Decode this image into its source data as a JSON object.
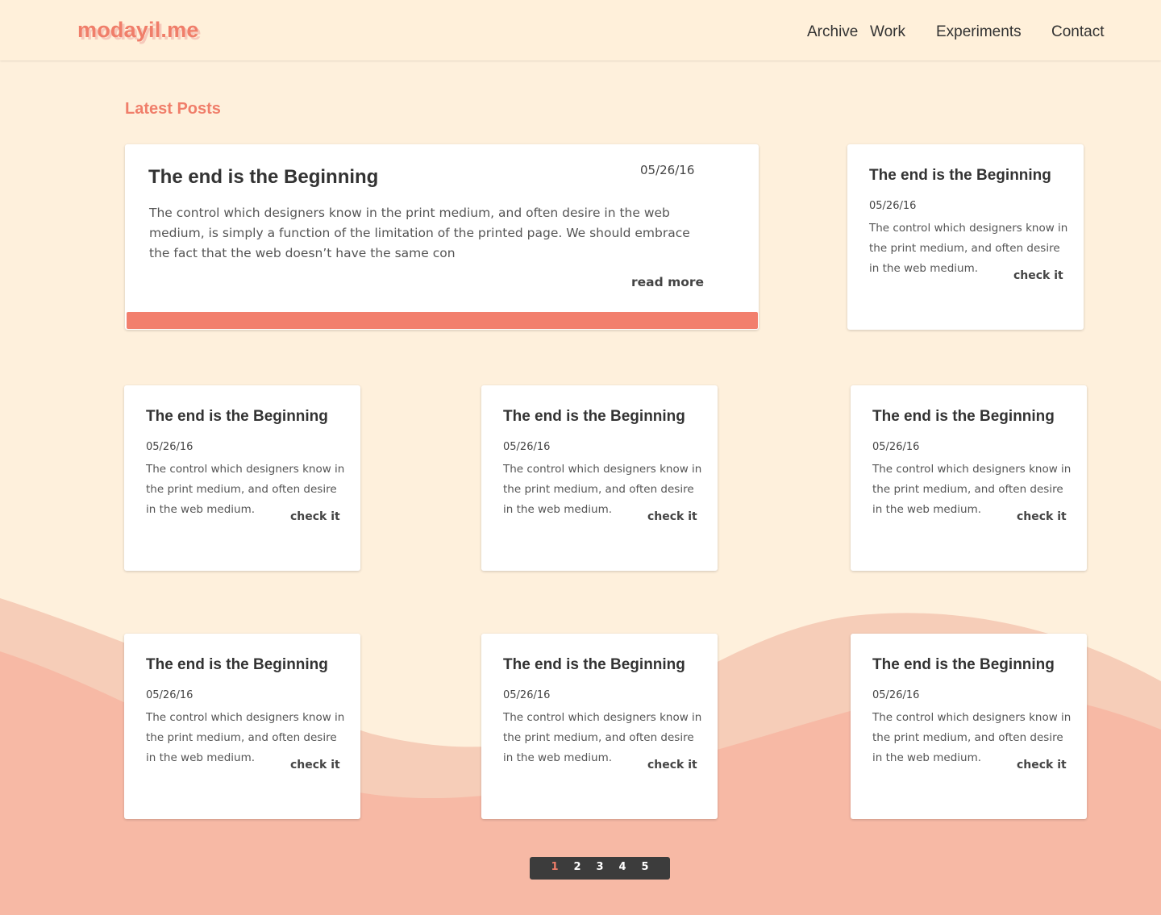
{
  "brand": {
    "logo": "modayil.me"
  },
  "nav": {
    "items": [
      "Archive",
      "Work",
      "Experiments",
      "Contact"
    ]
  },
  "main": {
    "section_title": "Latest Posts"
  },
  "featured": {
    "title": "The end is the Beginning",
    "date": "05/26/16",
    "excerpt": "The control which designers know in the print medium, and often desire in the web medium, is simply a function of the limitation of the printed page. We should embrace the fact that the web doesn’t have the same con",
    "read_more": "read more"
  },
  "posts": [
    {
      "title": "The end is the Beginning",
      "date": "05/26/16",
      "excerpt": "The control which designers know in the print medium, and often desire in the web medium.",
      "link": "check it"
    },
    {
      "title": "The end is the Beginning",
      "date": "05/26/16",
      "excerpt": "The control which designers know in the print medium, and often desire in the web medium.",
      "link": "check it"
    },
    {
      "title": "The end is the Beginning",
      "date": "05/26/16",
      "excerpt": "The control which designers know in the print medium, and often desire in the web medium.",
      "link": "check it"
    },
    {
      "title": "The end is the Beginning",
      "date": "05/26/16",
      "excerpt": "The control which designers know in the print medium, and often desire in the web medium.",
      "link": "check it"
    },
    {
      "title": "The end is the Beginning",
      "date": "05/26/16",
      "excerpt": "The control which designers know in the print medium, and often desire in the web medium.",
      "link": "check it"
    },
    {
      "title": "The end is the Beginning",
      "date": "05/26/16",
      "excerpt": "The control which designers know in the print medium, and often desire in the web medium.",
      "link": "check it"
    },
    {
      "title": "The end is the Beginning",
      "date": "05/26/16",
      "excerpt": "The control which designers know in the print medium, and often desire in the web medium.",
      "link": "check it"
    }
  ],
  "pagination": {
    "pages": [
      "1",
      "2",
      "3",
      "4",
      "5"
    ],
    "current": "1"
  },
  "colors": {
    "background": "#fef0dc",
    "accent": "#f07e6a",
    "wave_light": "#f6cdb8",
    "wave_dark": "#f7b9a5",
    "pagination_bg": "#3c3c3c"
  }
}
